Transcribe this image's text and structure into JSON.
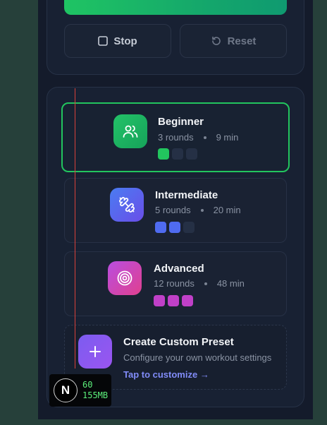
{
  "controls": {
    "stop_label": "Stop",
    "reset_label": "Reset",
    "start_color": "#1fc463"
  },
  "presets": [
    {
      "title": "Beginner",
      "rounds": "3 rounds",
      "duration": "9 min",
      "icon": "users-icon",
      "color": "#22c55e",
      "level": 1,
      "selected": true
    },
    {
      "title": "Intermediate",
      "rounds": "5 rounds",
      "duration": "20 min",
      "icon": "dumbbell-icon",
      "color": "#4f6bf0",
      "level": 2
    },
    {
      "title": "Advanced",
      "rounds": "12 rounds",
      "duration": "48 min",
      "icon": "target-icon",
      "color": "#c040c8",
      "level": 3
    }
  ],
  "custom": {
    "title": "Create Custom Preset",
    "subtitle": "Configure your own workout settings",
    "link": "Tap to customize →",
    "icon": "plus-icon",
    "color": "#8b5cf6"
  },
  "dev": {
    "logo": "N",
    "fps": "60",
    "memory": "155MB"
  }
}
